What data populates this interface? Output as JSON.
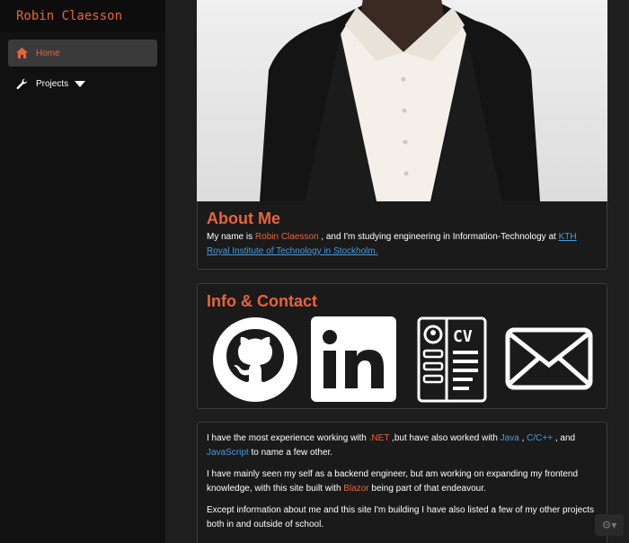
{
  "brand": {
    "name": "Robin Claesson"
  },
  "nav": {
    "items": [
      {
        "label": "Home",
        "icon": "home-icon",
        "active": true
      },
      {
        "label": "Projects",
        "icon": "wrench-icon",
        "has_dropdown": true
      }
    ]
  },
  "about": {
    "title": "About Me",
    "text_1": "My name is ",
    "name": "Robin Claesson",
    "text_2": " , and I'm studying engineering in Information-Technology at ",
    "school_link": "KTH Royal Institute of Technology in Stockholm."
  },
  "contact": {
    "title": "Info & Contact",
    "links": [
      {
        "icon": "github-icon"
      },
      {
        "icon": "linkedin-icon"
      },
      {
        "icon": "cv-icon"
      },
      {
        "icon": "mail-icon"
      }
    ]
  },
  "skills": {
    "p1_a": "I have the most experience working with ",
    "net": ".NET",
    "p1_b": " ,but have also worked with ",
    "java": "Java",
    "p1_c": " , ",
    "cpp": "C/C++",
    "p1_d": " , and ",
    "js": "JavaScript",
    "p1_e": " to name a few other.",
    "p2_a": "I have mainly seen my self as a backend engineer, but am working on expanding my frontend knowledge, with this site built with ",
    "blazor": "Blazor",
    "p2_b": " being part of that endeavour.",
    "p3": "Except information about me and this site I'm building I have also listed a few of my other projects both in and outside of school."
  },
  "colors": {
    "accent": "#e8643b",
    "link": "#4a9be0",
    "background": "#1e1e1e",
    "sidebar": "#111111"
  },
  "settings_button": {
    "icon": "gear-icon"
  }
}
